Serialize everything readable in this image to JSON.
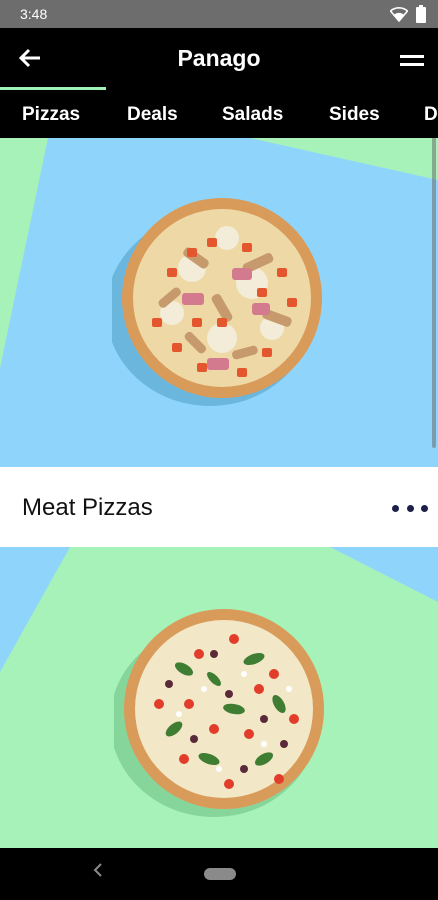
{
  "status_bar": {
    "time": "3:48"
  },
  "app_bar": {
    "title": "Panago"
  },
  "tabs": [
    {
      "label": "Pizzas",
      "selected": true
    },
    {
      "label": "Deals"
    },
    {
      "label": "Salads"
    },
    {
      "label": "Sides"
    },
    {
      "label": "D"
    }
  ],
  "categories": [
    {
      "label": "Meat Pizzas"
    }
  ],
  "colors": {
    "accent": "#9ff2b7",
    "bg_blue": "#8fd5fb",
    "bg_green": "#a6f2b8",
    "more_dots": "#1b1f4a"
  },
  "icons": {
    "back": "arrow-left-icon",
    "menu": "menu-icon",
    "more": "more-horizontal-icon",
    "wifi": "wifi-icon",
    "battery": "battery-icon"
  }
}
